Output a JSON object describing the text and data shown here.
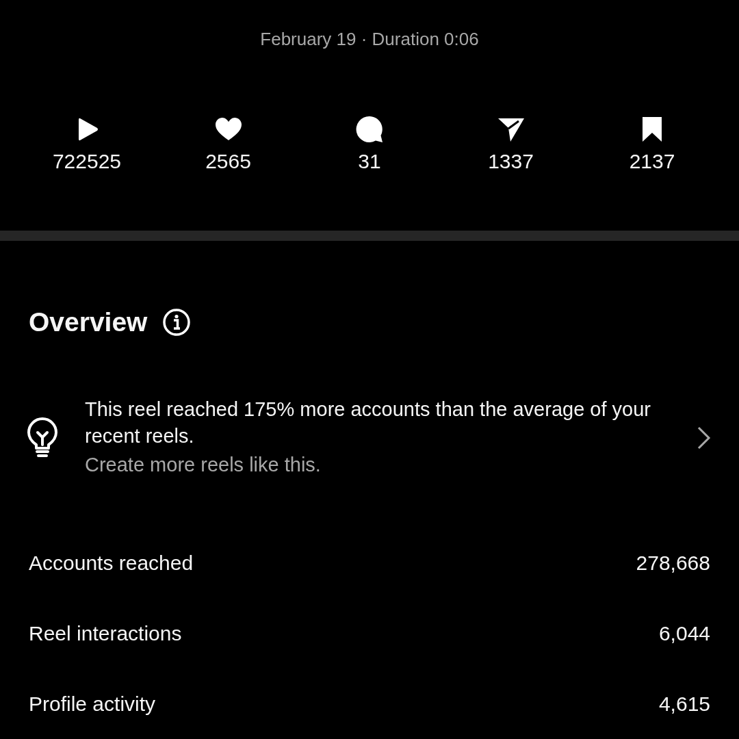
{
  "header": {
    "subtitle": "February 19 · Duration 0:06"
  },
  "stats": [
    {
      "kind": "plays",
      "value": "722525"
    },
    {
      "kind": "likes",
      "value": "2565"
    },
    {
      "kind": "comments",
      "value": "31"
    },
    {
      "kind": "shares",
      "value": "1337"
    },
    {
      "kind": "saves",
      "value": "2137"
    }
  ],
  "overview": {
    "title": "Overview",
    "insight": {
      "text": "This reel reached 175% more accounts than the average of your recent reels.",
      "hint": "Create more reels like this."
    },
    "metrics": [
      {
        "label": "Accounts reached",
        "value": "278,668"
      },
      {
        "label": "Reel interactions",
        "value": "6,044"
      },
      {
        "label": "Profile activity",
        "value": "4,615"
      }
    ]
  }
}
